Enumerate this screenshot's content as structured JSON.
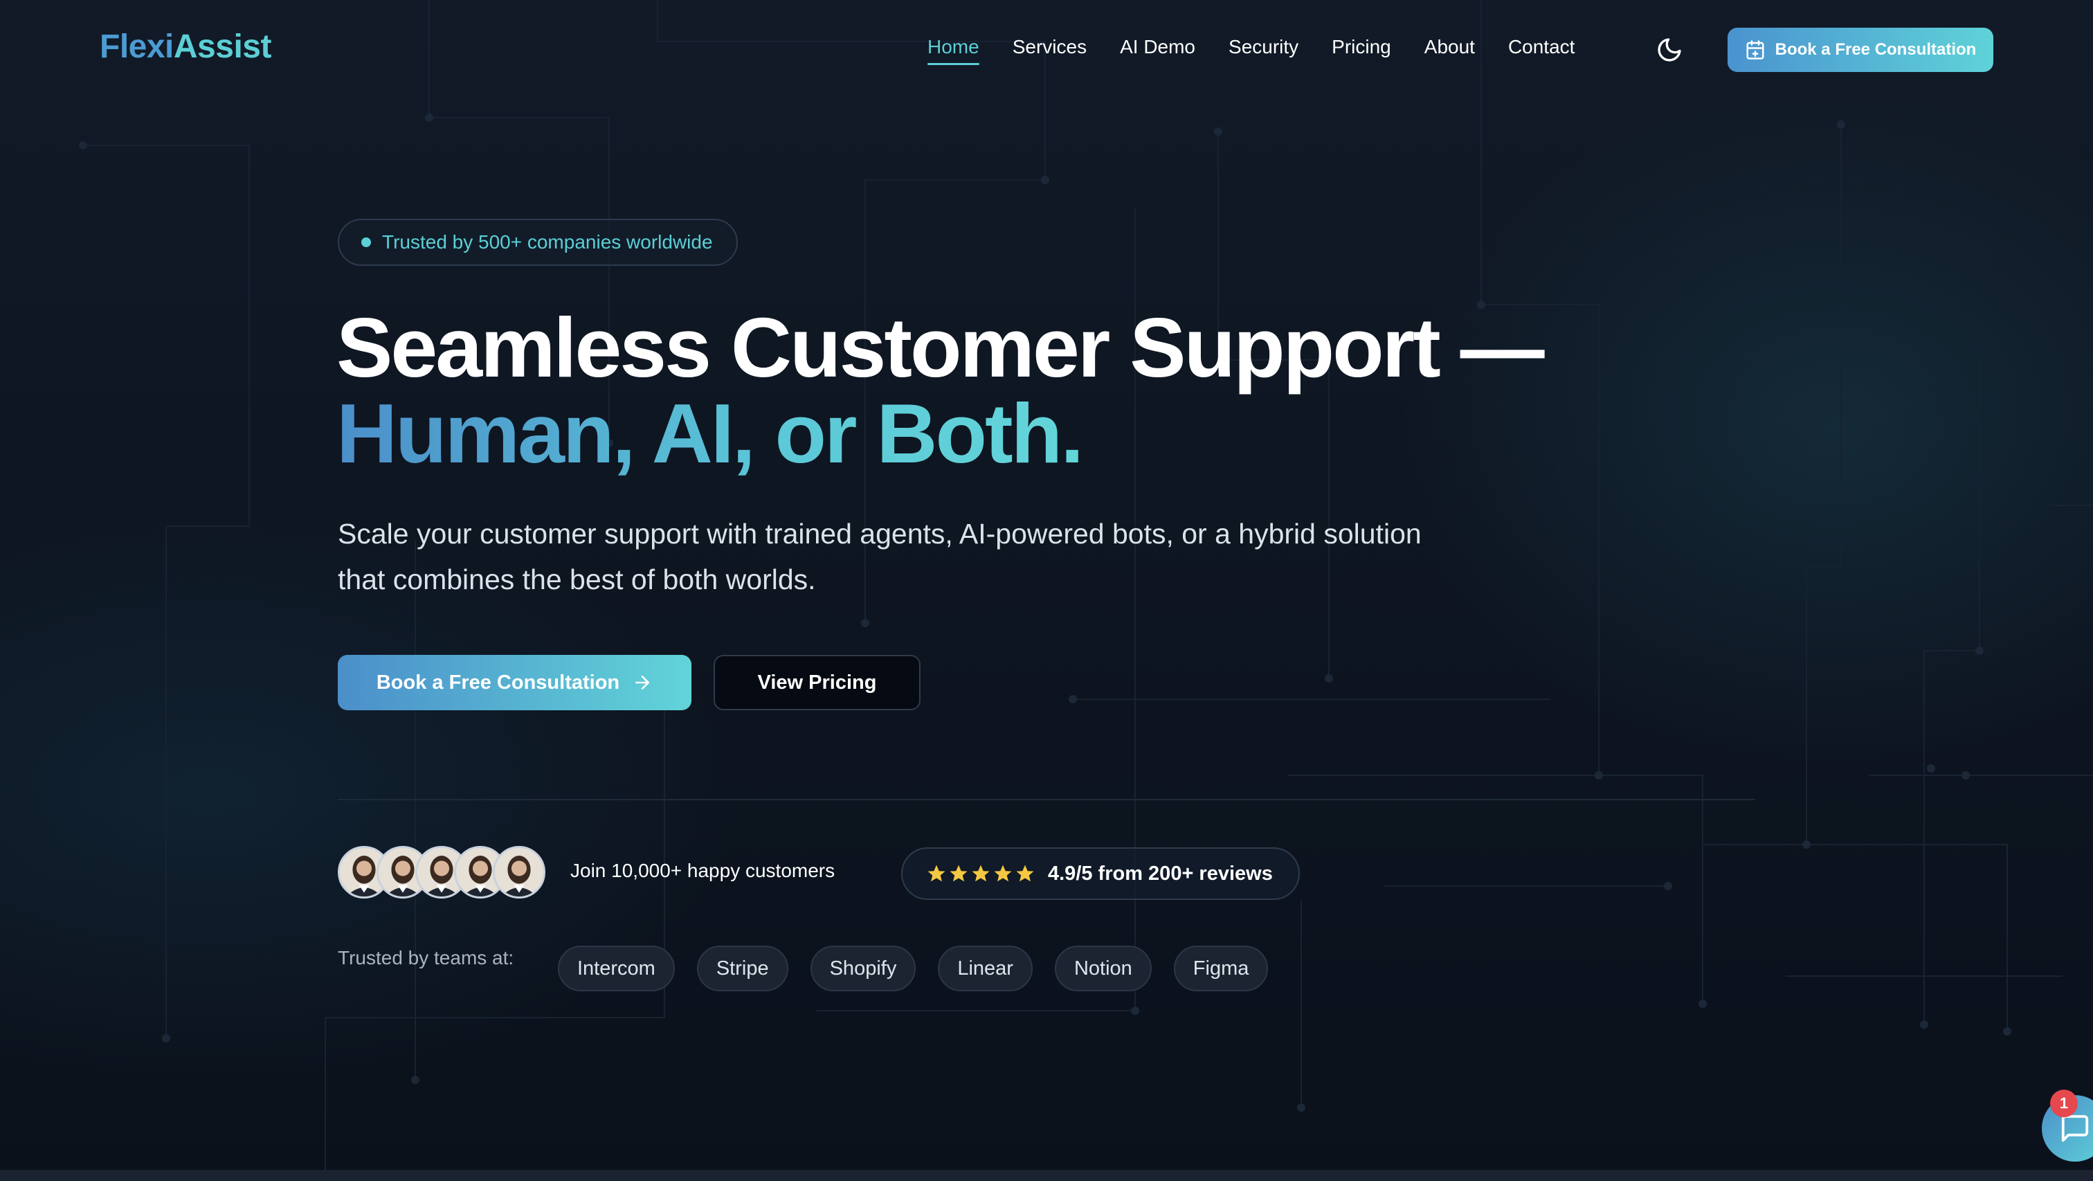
{
  "brand": {
    "part1": "Flexi",
    "part2": "Assist"
  },
  "nav": {
    "items": [
      {
        "label": "Home",
        "active": true
      },
      {
        "label": "Services"
      },
      {
        "label": "AI Demo"
      },
      {
        "label": "Security"
      },
      {
        "label": "Pricing"
      },
      {
        "label": "About"
      },
      {
        "label": "Contact"
      }
    ],
    "theme_icon": "moon-icon",
    "cta_label": "Book a Free Consultation",
    "cta_icon": "calendar-icon"
  },
  "hero": {
    "badge": "Trusted by 500+ companies worldwide",
    "headline_line1": "Seamless Customer Support —",
    "headline_line2": "Human, AI, or Both.",
    "subtitle": "Scale your customer support with trained agents, AI-powered bots, or a hybrid solution that combines the best of both worlds.",
    "primary_button": "Book a Free Consultation",
    "primary_button_icon": "arrow-right-icon",
    "secondary_button": "View Pricing"
  },
  "social_proof": {
    "avatar_count": 5,
    "join_text": "Join 10,000+ happy customers",
    "stars": 5,
    "rating_text": "4.9/5 from 200+ reviews",
    "trusted_label": "Trusted by teams at:",
    "companies": [
      "Intercom",
      "Stripe",
      "Shopify",
      "Linear",
      "Notion",
      "Figma"
    ]
  },
  "chat": {
    "icon": "chat-bubble-icon",
    "unread": "1"
  },
  "colors": {
    "accent_blue": "#4b8fca",
    "accent_teal": "#5ccfd6",
    "background": "#0c121d",
    "star": "#f5c842",
    "badge_red": "#e5484d"
  }
}
